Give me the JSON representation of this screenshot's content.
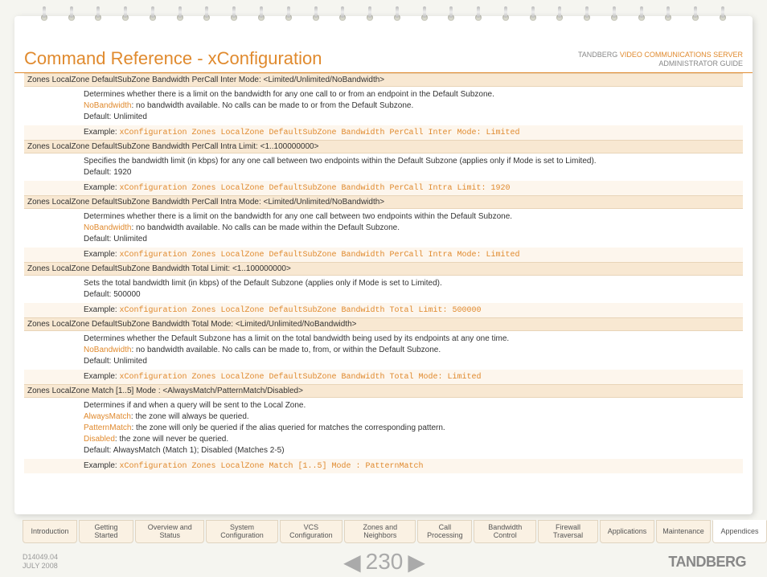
{
  "header": {
    "title": "Command Reference - xConfiguration",
    "company": "TANDBERG",
    "product": "VIDEO COMMUNICATIONS SERVER",
    "subtitle": "ADMINISTRATOR GUIDE"
  },
  "commands": [
    {
      "header": "Zones LocalZone DefaultSubZone Bandwidth PerCall Inter Mode: <Limited/Unlimited/NoBandwidth>",
      "desc": "Determines whether there is a limit on the bandwidth for any one call to or from an endpoint in the Default Subzone.",
      "kw": "NoBandwidth",
      "kwdesc": ": no bandwidth available. No calls can be made to or from the Default Subzone.",
      "default": "Default: Unlimited",
      "example_lbl": "Example:",
      "example": "xConfiguration Zones LocalZone DefaultSubZone Bandwidth PerCall Inter Mode: Limited"
    },
    {
      "header": "Zones LocalZone DefaultSubZone Bandwidth PerCall Intra Limit: <1..100000000>",
      "desc": "Specifies the bandwidth limit (in kbps) for any one call between two endpoints within the Default Subzone (applies only if Mode is set to Limited).",
      "default": "Default: 1920",
      "example_lbl": "Example:",
      "example": "xConfiguration Zones LocalZone DefaultSubZone Bandwidth PerCall Intra Limit: 1920"
    },
    {
      "header": "Zones LocalZone DefaultSubZone Bandwidth PerCall Intra Mode: <Limited/Unlimited/NoBandwidth>",
      "desc": "Determines whether there is a limit on the bandwidth for any one call between two endpoints within the Default Subzone.",
      "kw": "NoBandwidth",
      "kwdesc": ": no bandwidth available. No calls can be made within the Default Subzone.",
      "default": "Default: Unlimited",
      "example_lbl": "Example:",
      "example": "xConfiguration Zones LocalZone DefaultSubZone Bandwidth PerCall Intra Mode: Limited"
    },
    {
      "header": "Zones LocalZone DefaultSubZone Bandwidth Total Limit: <1..100000000>",
      "desc": "Sets the total bandwidth limit (in kbps) of the Default Subzone (applies only if Mode is set to Limited).",
      "default": "Default: 500000",
      "example_lbl": "Example:",
      "example": "xConfiguration Zones LocalZone DefaultSubZone Bandwidth Total Limit: 500000"
    },
    {
      "header": "Zones LocalZone DefaultSubZone Bandwidth Total Mode: <Limited/Unlimited/NoBandwidth>",
      "desc": "Determines whether the Default Subzone has a limit on the total bandwidth being used by its endpoints at any one time.",
      "kw": "NoBandwidth",
      "kwdesc": ": no bandwidth available. No calls can be made to, from, or within the Default Subzone.",
      "default": "Default: Unlimited",
      "example_lbl": "Example:",
      "example": "xConfiguration Zones LocalZone DefaultSubZone Bandwidth Total Mode: Limited"
    },
    {
      "header": "Zones LocalZone Match [1..5] Mode : <AlwaysMatch/PatternMatch/Disabled>",
      "desc": "Determines if and when a query will be sent to the Local Zone.",
      "extras": [
        {
          "kw": "AlwaysMatch",
          "txt": ": the zone will always be queried."
        },
        {
          "kw": "PatternMatch",
          "txt": ": the zone will only be queried if the alias queried for matches the corresponding pattern."
        },
        {
          "kw": "Disabled",
          "txt": ": the zone will never be queried."
        }
      ],
      "default": "Default: AlwaysMatch (Match 1); Disabled (Matches 2-5)",
      "example_lbl": "Example:",
      "example": "xConfiguration Zones LocalZone Match [1..5] Mode : PatternMatch"
    }
  ],
  "tabs": [
    "Introduction",
    "Getting Started",
    "Overview and Status",
    "System Configuration",
    "VCS Configuration",
    "Zones and Neighbors",
    "Call Processing",
    "Bandwidth Control",
    "Firewall Traversal",
    "Applications",
    "Maintenance",
    "Appendices"
  ],
  "active_tab": 11,
  "footer": {
    "docid": "D14049.04",
    "date": "JULY 2008",
    "page": "230",
    "brand": "TANDBERG"
  }
}
